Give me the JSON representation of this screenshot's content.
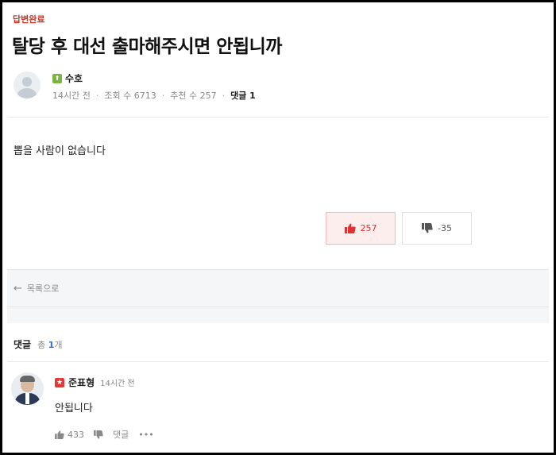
{
  "post": {
    "status": "답변완료",
    "title": "탈당 후 대선 출마해주시면 안됩니까",
    "author": "수호",
    "grade_icon": "grade-icon",
    "time": "14시간 전",
    "views": "조회 수 6713",
    "likes_meta": "추천 수 257",
    "comments_meta": "댓글 1",
    "body": "뽑을 사람이 없습니다",
    "upvotes": "257",
    "downvotes": "-35"
  },
  "nav": {
    "back_to_list": "목록으로"
  },
  "comments": {
    "header": "댓글",
    "total_prefix": "총",
    "total_count": "1",
    "total_suffix": "개",
    "items": [
      {
        "author": "준표형",
        "time": "14시간 전",
        "text": "안됩니다",
        "likes": "433",
        "reply_label": "댓글",
        "more_label": "•••"
      }
    ]
  },
  "colors": {
    "status": "#c0392b",
    "upvote_bg": "#fdeeee",
    "upvote_text": "#d33",
    "accent_blue": "#2f6fd6"
  }
}
